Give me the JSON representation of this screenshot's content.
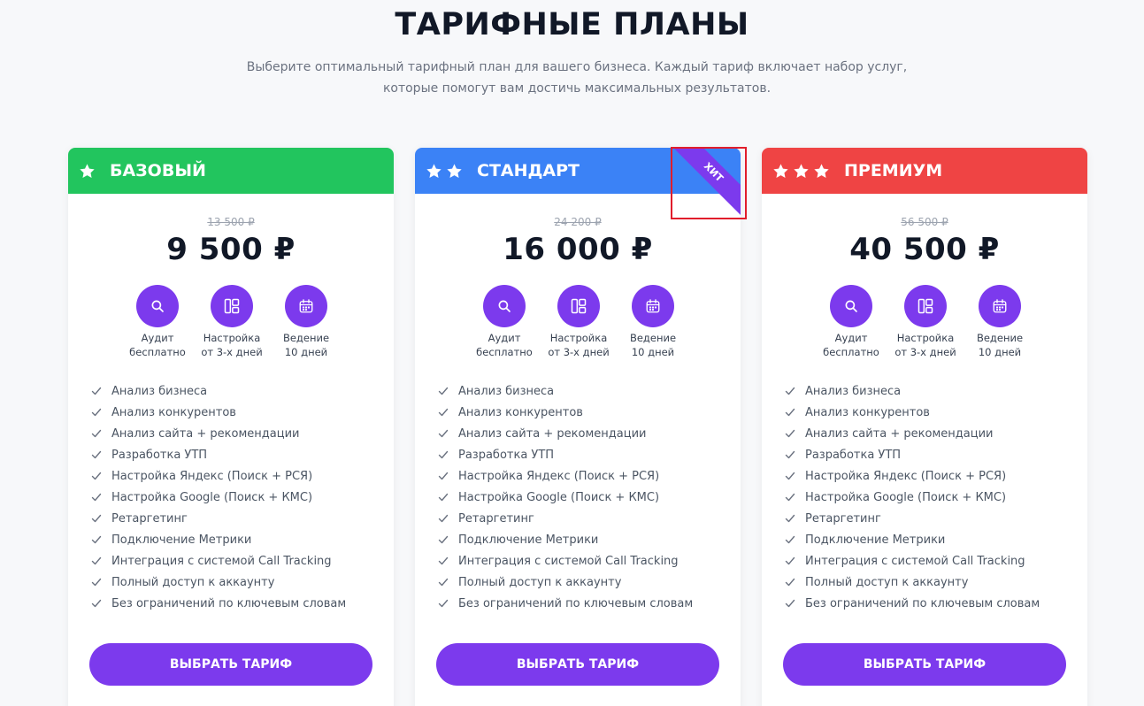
{
  "page": {
    "title": "ТАРИФНЫЕ ПЛАНЫ",
    "subtitle": "Выберите оптимальный тарифный план для вашего бизнеса. Каждый тариф включает набор услуг, которые помогут вам достичь максимальных результатов."
  },
  "colors": {
    "accent": "#7c3aed",
    "basic_header": "#22c55e",
    "standard_header": "#3b82f6",
    "premium_header": "#ef4444",
    "highlight_box": "#e11d2b"
  },
  "features": [
    {
      "icon": "search-icon",
      "label": "Аудит\nбесплатно"
    },
    {
      "icon": "layout-icon",
      "label": "Настройка\nот 3-х дней"
    },
    {
      "icon": "calendar-icon",
      "label": "Ведение\n10 дней"
    }
  ],
  "checklist": [
    "Анализ бизнеса",
    "Анализ конкурентов",
    "Анализ сайта + рекомендации",
    "Разработка УТП",
    "Настройка Яндекс (Поиск + РСЯ)",
    "Настройка Google (Поиск + КМС)",
    "Ретаргетинг",
    "Подключение Метрики",
    "Интеграция с системой Call Tracking",
    "Полный доступ к аккаунту",
    "Без ограничений по ключевым словам"
  ],
  "plans": [
    {
      "name": "БАЗОВЫЙ",
      "stars": 1,
      "old_price": "13 500 ₽",
      "price": "9 500 ₽",
      "button": "ВЫБРАТЬ ТАРИФ"
    },
    {
      "name": "СТАНДАРТ",
      "stars": 2,
      "old_price": "24 200 ₽",
      "price": "16 000 ₽",
      "button": "ВЫБРАТЬ ТАРИФ",
      "ribbon": "ХИТ"
    },
    {
      "name": "ПРЕМИУМ",
      "stars": 3,
      "old_price": "56 500 ₽",
      "price": "40 500 ₽",
      "button": "ВЫБРАТЬ ТАРИФ"
    }
  ]
}
